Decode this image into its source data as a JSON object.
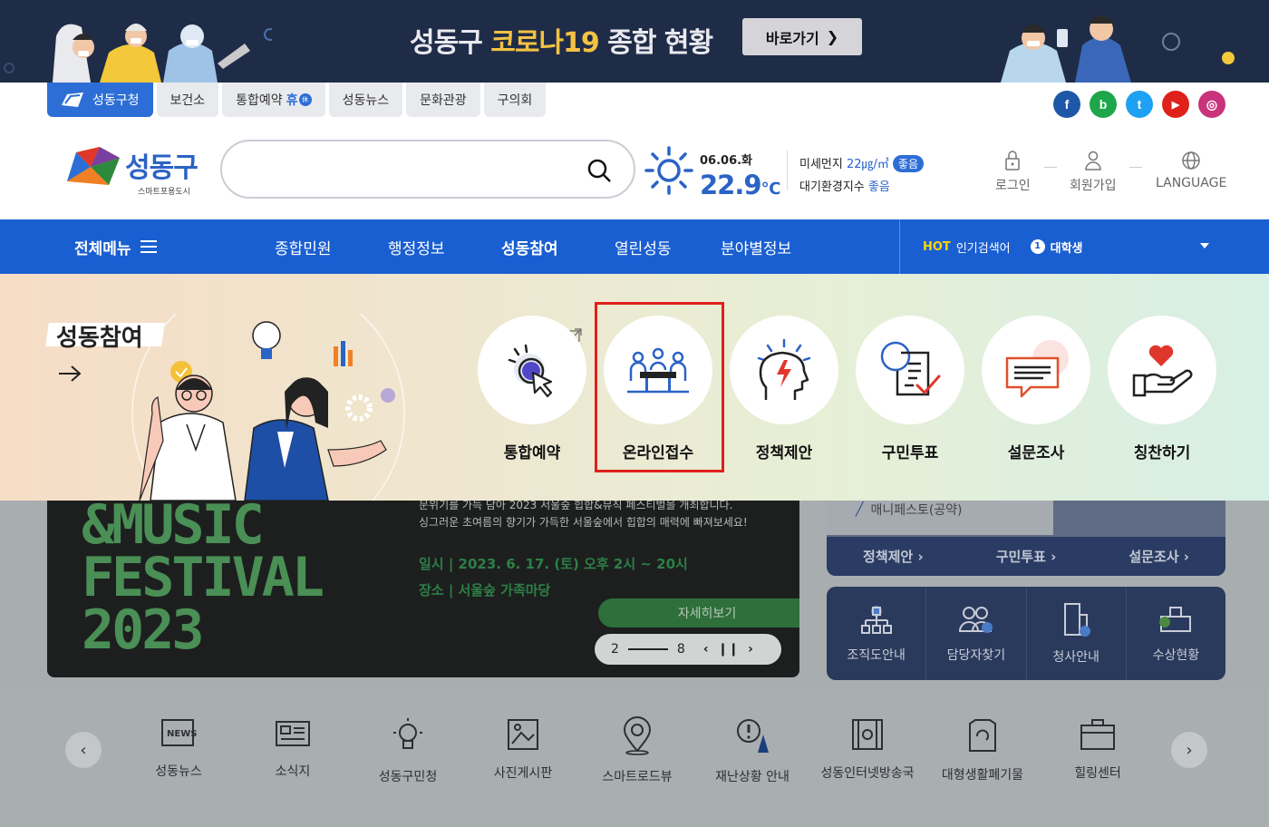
{
  "banner": {
    "title_pre": "성동구 ",
    "title_hl": "코로나19",
    "title_post": " 종합 현황",
    "button": "바로가기"
  },
  "site_tabs": [
    {
      "label": "성동구청",
      "active": true
    },
    {
      "label": "보건소"
    },
    {
      "label": "통합예약",
      "suffix": "휴",
      "badge": "休"
    },
    {
      "label": "성동뉴스"
    },
    {
      "label": "문화관광"
    },
    {
      "label": "구의회"
    }
  ],
  "sns": [
    {
      "name": "facebook",
      "glyph": "f",
      "color": "#1f57a8"
    },
    {
      "name": "blog",
      "glyph": "b",
      "color": "#1ea64a"
    },
    {
      "name": "twitter",
      "glyph": "t",
      "color": "#1da1f2"
    },
    {
      "name": "youtube",
      "glyph": "▶",
      "color": "#e0201b"
    },
    {
      "name": "instagram",
      "glyph": "◎",
      "color": "#c9337c"
    }
  ],
  "logo": {
    "name": "성동구",
    "tagline": "스마트포용도시"
  },
  "search": {
    "placeholder": ""
  },
  "weather": {
    "date": "06.06.화",
    "temp": "22.9",
    "unit": "℃"
  },
  "dust": {
    "label": "미세먼지 ",
    "value": "22㎍/㎥",
    "grade": "좋음"
  },
  "air": {
    "label": "대기환경지수 ",
    "value": "좋음"
  },
  "util": {
    "login": "로그인",
    "signup": "회원가입",
    "language": "LANGUAGE"
  },
  "nav": {
    "all_menu": "전체메뉴",
    "items": [
      "종합민원",
      "행정정보",
      "성동참여",
      "열린성동",
      "분야별정보"
    ],
    "hot_label": "HOT",
    "hot_text": "인기검색어",
    "hot_rank": "1",
    "hot_keyword": "대학생"
  },
  "panel": {
    "title": "성동참여",
    "cards": [
      "통합예약",
      "온라인접수",
      "정책제안",
      "구민투표",
      "설문조사",
      "칭찬하기"
    ]
  },
  "slide": {
    "big": [
      "&MUSIC",
      "FESTIVAL",
      "2023"
    ],
    "desc1": "문위기를 가득 담아 2023 서울숲 힙합&뮤직 페스티벌을 개최합니다.",
    "desc2": "싱그러운 초여름의 향기가 가득한 서울숲에서 힙합의 매력에 빠져보세요!",
    "info1": "일시  |  2023. 6. 17. (토) 오후 2시 ~ 20시",
    "info2": "장소  |  서울숲 가족마당",
    "more": "자세히보기",
    "current": "2",
    "total": "8"
  },
  "right": {
    "manifest": "매니페스토(공약)",
    "links": [
      "정책제안 ›",
      "구민투표 ›",
      "설문조사 ›"
    ],
    "quick": [
      "조직도안내",
      "담당자찾기",
      "청사안내",
      "수상현황"
    ]
  },
  "bottom_menu": [
    "성동뉴스",
    "소식지",
    "성동구민청",
    "사진게시판",
    "스마트로드뷰",
    "재난상황 안내",
    "성동인터넷방송국",
    "대형생활폐기물",
    "힐링센터"
  ]
}
